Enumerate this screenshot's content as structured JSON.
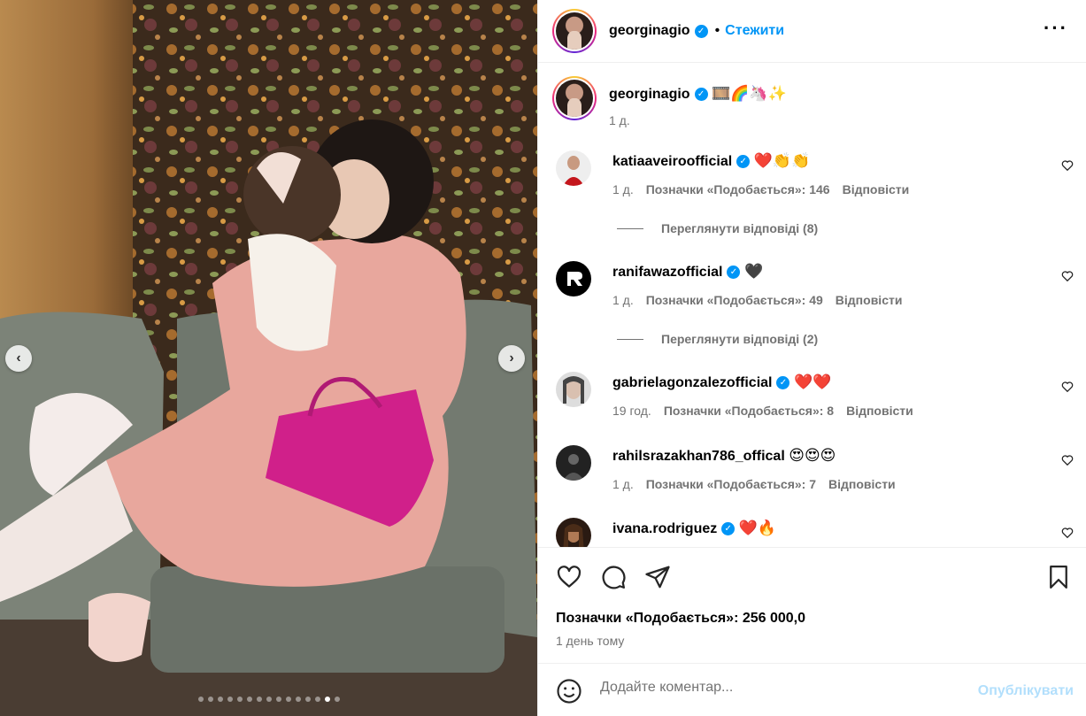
{
  "media": {
    "prev_icon": "chevron-left-icon",
    "next_icon": "chevron-right-icon",
    "dots_total": 15,
    "dots_active_index": 13
  },
  "header": {
    "username": "georginagio",
    "separator": "•",
    "follow_label": "Стежити",
    "more_icon": "more-horizontal-icon"
  },
  "caption": {
    "username": "georginagio",
    "text": "🎞️🌈🦄✨",
    "time": "1 д."
  },
  "comments": [
    {
      "username": "katiaaveiroofficial",
      "text": "❤️👏👏",
      "time": "1 д.",
      "likes": "Позначки «Подобається»: 146",
      "reply": "Відповісти",
      "view_replies": "Переглянути відповіді (8)"
    },
    {
      "username": "ranifawazofficial",
      "text": "🖤",
      "time": "1 д.",
      "likes": "Позначки «Подобається»: 49",
      "reply": "Відповісти",
      "view_replies": "Переглянути відповіді (2)"
    },
    {
      "username": "gabrielagonzalezofficial",
      "text": "❤️❤️",
      "time": "19 год.",
      "likes": "Позначки «Подобається»: 8",
      "reply": "Відповісти"
    },
    {
      "username": "rahilsrazakhan786_offical",
      "text": "😍😍😍",
      "time": "1 д.",
      "likes": "Позначки «Подобається»: 7",
      "reply": "Відповісти"
    },
    {
      "username": "ivana.rodriguez",
      "text": "❤️🔥"
    }
  ],
  "actions": {
    "like_icon": "heart-icon",
    "comment_icon": "comment-icon",
    "share_icon": "share-icon",
    "save_icon": "bookmark-icon"
  },
  "likes_total": "Позначки «Подобається»: 256 000,0",
  "posted_ago": "1 день тому",
  "add_comment": {
    "placeholder": "Додайте коментар...",
    "publish_label": "Опублікувати",
    "emoji_icon": "smiley-icon"
  },
  "colors": {
    "accent": "#0095f6",
    "muted": "#737373",
    "publish_disabled": "#b2dffc"
  }
}
